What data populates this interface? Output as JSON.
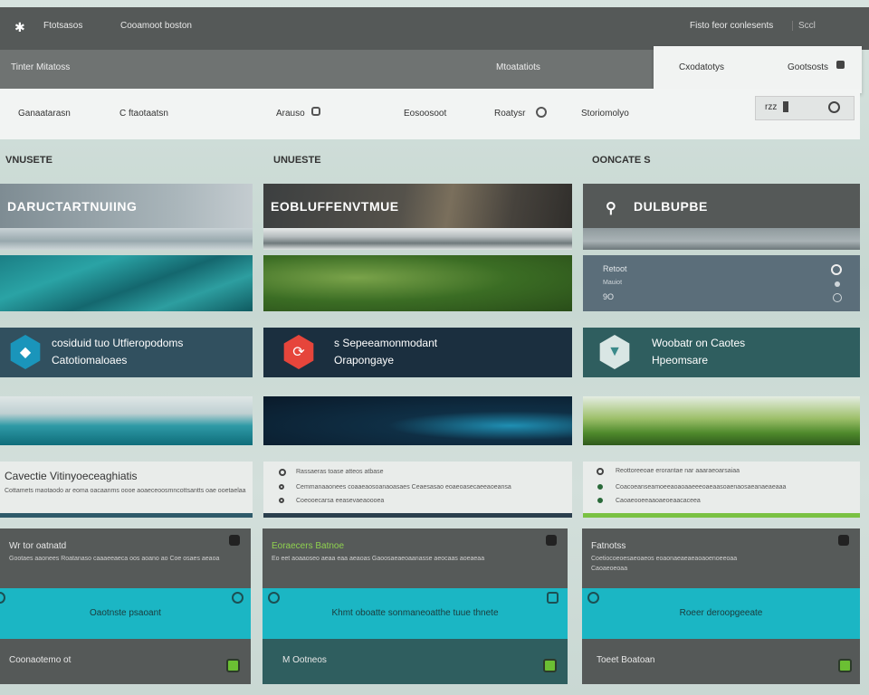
{
  "topbar": {
    "logo_icon": "app-logo-icon",
    "item1": "Ftotsasos",
    "item2": "Cooamoot boston",
    "right1": "Fisto feor conlesents",
    "right2": "Sccl"
  },
  "secondbar": {
    "left": "Tinter Mitatoss",
    "center": "Mtoatatiots"
  },
  "popup": {
    "left": "Cxodatotys",
    "right": "Gootsosts"
  },
  "nav": {
    "items": [
      "Ganaatarasn",
      "C ftaotaatsn",
      "Arauso",
      "Eosoosoot",
      "Roatysr",
      "Storiomolyo"
    ],
    "box_label": "rzz"
  },
  "columns": {
    "col1": "VNUSETE",
    "col2": "UNUESTE",
    "col3": "OONCATE S"
  },
  "banners": {
    "b1": "DARUCTARTNUIING",
    "b2": "EOBLUFFENVTMUE",
    "b3": "DULBUPBE"
  },
  "card3": {
    "line1": "Retoot",
    "line2": "Mauiot",
    "line3": "9O"
  },
  "panels": {
    "p1_line1": "cosiduid tuo Utfieropodoms",
    "p1_line2": "Catotiomaloaes",
    "p2_line1": "s Sepeeamonmodant",
    "p2_line2": "Orapongaye",
    "p3_line1": "Woobatr on Caotes",
    "p3_line2": "Hpeomsare"
  },
  "lightcards": {
    "c1_title": "Cavectie Vitinyoeceaghiatis",
    "c1_sub": "Cottamets maotaodo ar eoma oacaanms oooe aoaeceoosmncottsantts oae ooetaelaa",
    "c2_row1": "Rassaeras toase atteos atbase",
    "c2_row2": "Cemmanaaonees  coaaeaosoanaoasaes  Ceaesasao  eoaeoasecaeeaoeansa",
    "c2_row3": "Coeooecarsa  eeasevaeaoooea",
    "c3_row1": "Reottoreeoae erorantae nar aaaraeoarsaiaa",
    "c3_row2": "Coacoeanseamoeeaoaoaaeeeoaeaasoaenaosaeanaeaeaaa",
    "c3_row3": "Caoaeooeeaaoaeoeaacaceea"
  },
  "darkcards": {
    "d1_title": "Wr tor oatnatd",
    "d1_sub": "Gootaes aaonees  Roatanaso caaaeeaeca  oos aoano ao  Coe osaes  aeaoa",
    "d2_title": "Eoraecers Batnoe",
    "d2_sub": "Eo eet aoaaoseo aeaa  eaa aeaoas  Gaoosaeaeoaanasse  aeocaas  aoeaeaa",
    "d3_title": "Fatnotss",
    "d3_sub": "Coetiocoeoesaeoaeos  eoaonaeaeaeaoaoenoeeoaa",
    "d3_sub2": "Caoaeoeoaa"
  },
  "cyans": {
    "k1": "Oaotnste psaoant",
    "k2": "Khmt oboatte sonmaneoatthe tuue thnete",
    "k3": "Roeer deroopgeeate"
  },
  "footers": {
    "f1": "Coonaotemo ot",
    "f2": "M  Ootneos",
    "f3": "Toeet Boatoan"
  },
  "colors": {
    "accent_teal": "#1bb6c4",
    "accent_green": "#7ac143",
    "dark_navy": "#1b2f3f",
    "dark_gray": "#565a59",
    "red_hex": "#e6453b"
  }
}
